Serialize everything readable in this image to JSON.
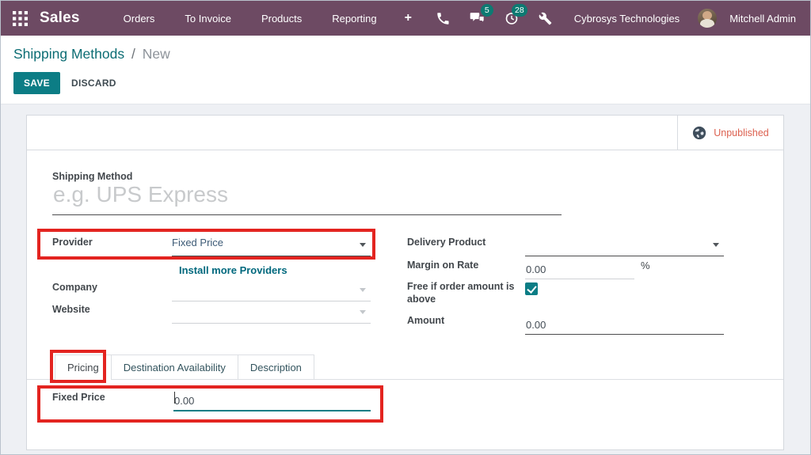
{
  "navbar": {
    "app_name": "Sales",
    "menu_items": [
      "Orders",
      "To Invoice",
      "Products",
      "Reporting"
    ],
    "plus_label": "+",
    "message_badge": "5",
    "activity_badge": "28",
    "company_name": "Cybrosys Technologies",
    "user_name": "Mitchell Admin"
  },
  "control_panel": {
    "breadcrumb_parent": "Shipping Methods",
    "breadcrumb_separator": "/",
    "breadcrumb_current": "New",
    "save_label": "SAVE",
    "discard_label": "DISCARD"
  },
  "sheet": {
    "status_button_label": "Unpublished",
    "shipping_method": {
      "label": "Shipping Method",
      "placeholder": "e.g. UPS Express",
      "value": ""
    },
    "provider": {
      "label": "Provider",
      "value": "Fixed Price"
    },
    "install_more_link": "Install more Providers",
    "company": {
      "label": "Company",
      "value": ""
    },
    "website": {
      "label": "Website",
      "value": ""
    },
    "delivery_product": {
      "label": "Delivery Product",
      "value": ""
    },
    "margin_on_rate": {
      "label": "Margin on Rate",
      "value": "0.00",
      "suffix": "%"
    },
    "free_if_order": {
      "label": "Free if order amount is above",
      "checked": true
    },
    "amount": {
      "label": "Amount",
      "value": "0.00"
    },
    "tabs": [
      {
        "label": "Pricing",
        "active": true
      },
      {
        "label": "Destination Availability",
        "active": false
      },
      {
        "label": "Description",
        "active": false
      }
    ],
    "pricing_tab": {
      "fixed_price_label": "Fixed Price",
      "fixed_price_value": "0.00"
    }
  },
  "colors": {
    "navbar_bg": "#6d4a63",
    "accent_teal": "#0c7d85",
    "badge_teal": "#0d7a72",
    "link_teal": "#00687d",
    "breadcrumb_teal": "#0c6d74",
    "unpublished_red": "#dc6150",
    "annotation_red": "#e32420",
    "page_bg": "#eef0f4"
  },
  "icons": {
    "apps_icon": "3x3-grid",
    "phone_icon": "phone-receiver",
    "messages_icon": "chat-bubbles",
    "activity_icon": "clock",
    "tools_icon": "wrench",
    "globe_icon": "globe",
    "dropdown_caret_icon": "triangle-down",
    "checkmark_icon": "check"
  }
}
